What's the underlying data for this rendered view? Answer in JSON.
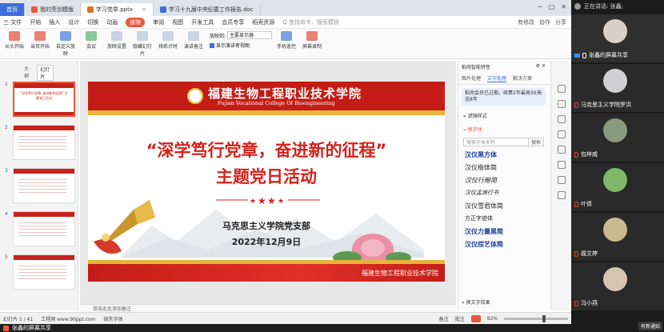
{
  "tabs": [
    {
      "label": "首页"
    },
    {
      "label": "我的亮剑模版"
    },
    {
      "label": "学习党章.pptx"
    },
    {
      "label": "学习十九届中央纪委工作报告.doc"
    }
  ],
  "menu": {
    "items": [
      "三 文件",
      "开始",
      "插入",
      "设计",
      "切换",
      "动画",
      "放映",
      "审阅",
      "视图",
      "开发工具",
      "会员专享",
      "稻壳资源"
    ],
    "selected_index": 6,
    "search": "Q 查找命令、搜索模板",
    "right": [
      "有修改",
      "协作",
      "分享"
    ]
  },
  "ribbon": {
    "buttons": [
      "从头开始",
      "当页开始",
      "自定义放映",
      "会议",
      "放映设置",
      "隐藏幻灯片",
      "排练计时",
      "演讲备注"
    ],
    "monitor_label": "放映到:",
    "monitor_value": "主要显示器",
    "presenter_view": "显示演讲者视图",
    "right_buttons": [
      "手机遥控",
      "屏幕录制"
    ]
  },
  "thumbs": {
    "tab_outline": "大纲",
    "tab_slides": "幻灯片",
    "numbers": [
      "1",
      "2",
      "3",
      "4",
      "5"
    ],
    "slide1_text": "\"深学笃行党章, 奋进新的征程\" 主题党日活动"
  },
  "slide": {
    "school_cn": "福建生物工程职业技术学院",
    "school_en": "Fujian Vocational College Of Bioengineering",
    "title_line1": "“深学笃行党章，奋进新的征程”",
    "title_line2": "主题党日活动",
    "department": "马克思主义学院党支部",
    "date": "2022年12月9日",
    "footer_school": "福建生物工程职业技术学院"
  },
  "notes_placeholder": "单击此处添加备注",
  "right_panel": {
    "header": "稻壳智能特性",
    "tabs": [
      "图片处理",
      "文字处理",
      "解决方案"
    ],
    "selected_tab": 1,
    "notice": "稻壳会员已过期，续费2年最高30天送8年",
    "section1": "» 滤镜样式",
    "section2": "» 换字体",
    "search_placeholder": "搜索字体名称",
    "search_btn": "搜索",
    "fonts": [
      "汉仪黑方体",
      "汉仪楷体简",
      "汉仪行楷简",
      "汉仪孟浪行书",
      "汉仪雪君体简",
      "方正字迹体",
      "汉仪力量黑简",
      "汉仪综艺体简"
    ],
    "footer": "» 换文字效果"
  },
  "status": {
    "slide_info": "幻灯片 1 / 41",
    "theme": "工程网 www.90ppt.com",
    "font_missing": "缺失字体",
    "notes": "备注",
    "comments": "批注",
    "zoom": "92%"
  },
  "share_bar": "张鑫的屏幕共享",
  "meeting": {
    "speaking": "正在讲话: 张鑫;",
    "participants": [
      {
        "name": "张鑫的屏幕共享",
        "mic": "on"
      },
      {
        "name": "马克思主义学院罗洪",
        "mic": "off"
      },
      {
        "name": "包梓威",
        "mic": "off"
      },
      {
        "name": "叶倩",
        "mic": "off"
      },
      {
        "name": "聂文婷",
        "mic": "off"
      },
      {
        "name": "冯小燕",
        "mic": "off"
      }
    ],
    "new_message": "有新通知"
  }
}
